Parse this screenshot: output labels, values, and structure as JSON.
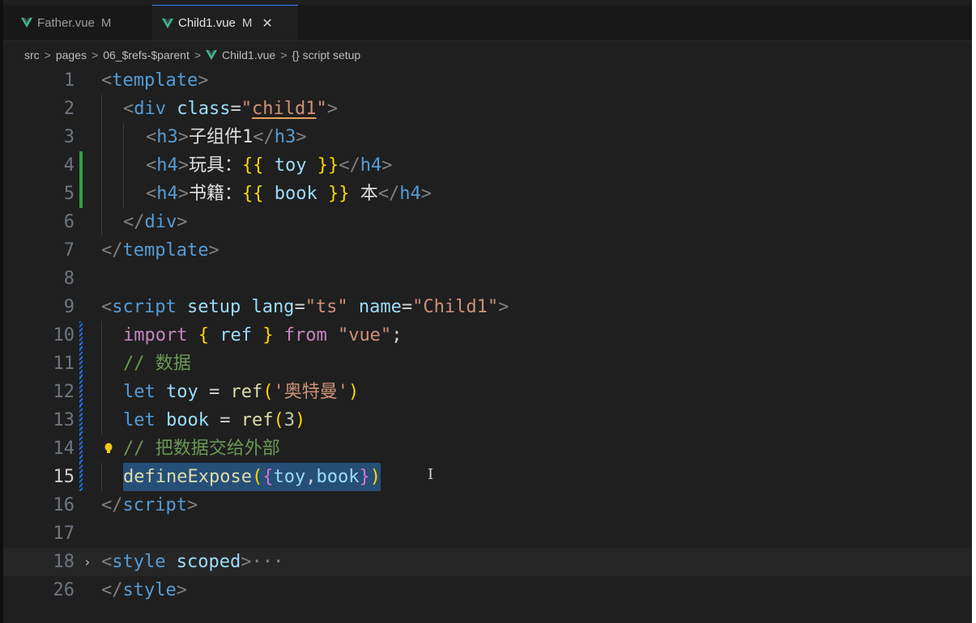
{
  "tabs": [
    {
      "label": "Father.vue",
      "status": "M",
      "active": false,
      "icon": "vue-icon"
    },
    {
      "label": "Child1.vue",
      "status": "M",
      "active": true,
      "icon": "vue-icon",
      "close": "✕"
    }
  ],
  "breadcrumb": {
    "items": [
      "src",
      "pages",
      "06_$refs-$parent",
      "Child1.vue",
      "{} script setup"
    ],
    "separator": ">"
  },
  "editor": {
    "current_line": 15,
    "lines": [
      {
        "n": "1"
      },
      {
        "n": "2"
      },
      {
        "n": "3"
      },
      {
        "n": "4"
      },
      {
        "n": "5"
      },
      {
        "n": "6"
      },
      {
        "n": "7"
      },
      {
        "n": "8"
      },
      {
        "n": "9"
      },
      {
        "n": "10"
      },
      {
        "n": "11"
      },
      {
        "n": "12"
      },
      {
        "n": "13"
      },
      {
        "n": "14"
      },
      {
        "n": "15"
      },
      {
        "n": "16"
      },
      {
        "n": "17"
      },
      {
        "n": "18"
      },
      {
        "n": "26"
      }
    ],
    "code": {
      "l1": {
        "open": "<",
        "tag": "template",
        "close": ">"
      },
      "l2": {
        "open": "<",
        "tag": "div",
        "attr": " class",
        "eq": "=",
        "q1": "\"",
        "val": "child1",
        "q2": "\"",
        "close": ">"
      },
      "l3": {
        "open": "<",
        "tag": "h3",
        "close": ">",
        "text": "子组件1",
        "open2": "</",
        "tag2": "h3",
        "close2": ">"
      },
      "l4": {
        "open": "<",
        "tag": "h4",
        "close": ">",
        "text": "玩具：",
        "b1": "{{",
        "var": " toy ",
        "b2": "}}",
        "open2": "</",
        "tag2": "h4",
        "close2": ">"
      },
      "l5": {
        "open": "<",
        "tag": "h4",
        "close": ">",
        "text": "书籍：",
        "b1": "{{",
        "var": " book ",
        "b2": "}}",
        "text2": " 本",
        "open2": "</",
        "tag2": "h4",
        "close2": ">"
      },
      "l6": {
        "open": "</",
        "tag": "div",
        "close": ">"
      },
      "l7": {
        "open": "</",
        "tag": "template",
        "close": ">"
      },
      "l9": {
        "open": "<",
        "tag": "script",
        "attr1": " setup lang",
        "eq": "=",
        "val1": "\"ts\"",
        "attr2": " name",
        "eq2": "=",
        "val2": "\"Child1\"",
        "close": ">"
      },
      "l10": {
        "kw": "import",
        "b1": " {",
        "var": " ref ",
        "b2": "}",
        "kw2": " from",
        "str": " \"vue\"",
        "semi": ";"
      },
      "l11": {
        "comment": "// 数据"
      },
      "l12": {
        "kw": "let",
        "var": " toy",
        "eq": " = ",
        "fn": "ref",
        "p1": "(",
        "str": "'奥特曼'",
        "p2": ")"
      },
      "l13": {
        "kw": "let",
        "var": " book",
        "eq": " = ",
        "fn": "ref",
        "p1": "(",
        "num": "3",
        "p2": ")"
      },
      "l14": {
        "comment": "// 把数据交给外部"
      },
      "l15": {
        "fn": "defineExpose",
        "p1": "(",
        "b1": "{",
        "v1": "toy",
        "comma": ",",
        "v2": "book",
        "b2": "}",
        "p2": ")"
      },
      "l16": {
        "open": "</",
        "tag": "script",
        "close": ">"
      },
      "l18": {
        "open": "<",
        "tag": "style",
        "attr": " scoped",
        "close": ">",
        "ellipsis": "···"
      },
      "l26": {
        "open": "</",
        "tag": "style",
        "close": ">"
      }
    },
    "fold_indicator": "›",
    "text_cursor": "I"
  },
  "colors": {
    "background": "#1f1f1f",
    "selection": "#264f78",
    "tag": "#569cd6",
    "string": "#ce9178",
    "comment": "#6a9955",
    "bracket_gold": "#ffd700",
    "git_added": "#2ea043",
    "git_modified": "#1f6feb"
  }
}
